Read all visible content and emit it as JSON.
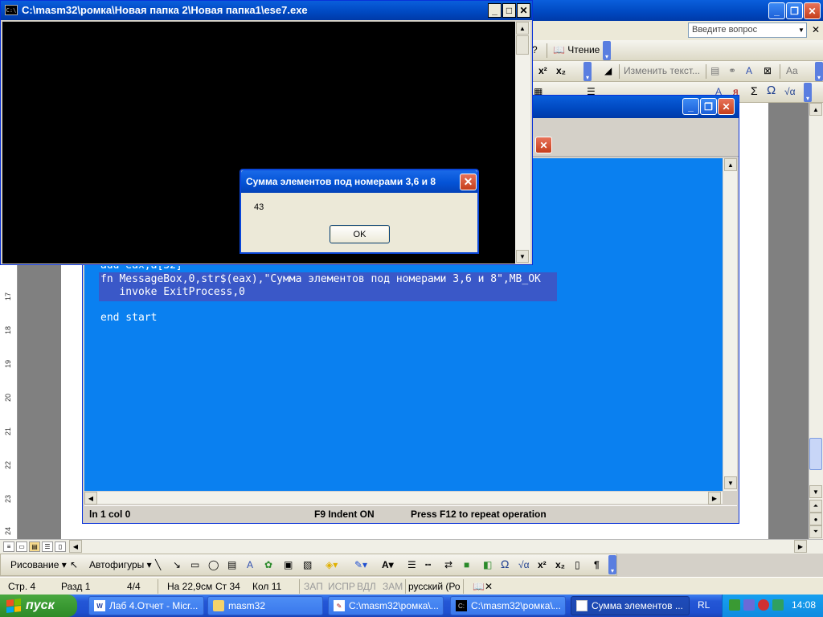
{
  "console": {
    "title": "C:\\masm32\\ромка\\Новая папка 2\\Новая папка1\\ese7.exe",
    "icon": "C:\\",
    "minimize": "_",
    "maximize": "□",
    "close": "✕"
  },
  "msgbox": {
    "title": "Сумма элементов под номерами 3,6 и 8",
    "text": "43",
    "ok_label": "OK",
    "close": "✕"
  },
  "word": {
    "help_placeholder": "Введите вопрос",
    "reading_label": "Чтение",
    "change_text_label": "Изменить текст...",
    "aa_label": "Aa",
    "sigma": "Σ",
    "omega": "Ω",
    "sqrt": "√α",
    "sup": "x²",
    "sub": "x₂",
    "ruler_numbers": [
      "17",
      "18",
      "19",
      "20",
      "21",
      "22",
      "23",
      "24"
    ],
    "drawing_label": "Рисование ▾",
    "autoshapes_label": "Автофигуры ▾",
    "status": {
      "page": "Стр. 4",
      "section": "Разд 1",
      "pages": "4/4",
      "at": "На 22,9см",
      "line": "Ст 34",
      "col": "Кол 11",
      "rec": "ЗАП",
      "trk": "ИСПР",
      "ext": "ВДЛ",
      "ovr": "ЗАМ",
      "lang": "русский (Ро"
    }
  },
  "editor": {
    "code_lines": [
      "add eax,a[32]",
      "fn MessageBox,0,str$(eax),\"Сумма элементов под номерами 3,6 и 8\",MB_OK",
      "   invoke ExitProcess,0",
      "",
      "end start"
    ],
    "status_pos": "ln 1 col 0",
    "status_indent": "F9 Indent ON",
    "status_repeat": "Press F12 to repeat operation"
  },
  "taskbar": {
    "start_label": "пуск",
    "items": [
      {
        "label": "Лаб 4.Отчет - Micr...",
        "icon": "word-icon"
      },
      {
        "label": "masm32",
        "icon": "folder-icon"
      },
      {
        "label": "C:\\masm32\\ромка\\...",
        "icon": "editor-icon"
      },
      {
        "label": "C:\\masm32\\ромка\\...",
        "icon": "console-icon"
      },
      {
        "label": "Сумма элементов ...",
        "icon": "window-icon"
      }
    ],
    "lang": "RL",
    "clock": "14:08"
  }
}
